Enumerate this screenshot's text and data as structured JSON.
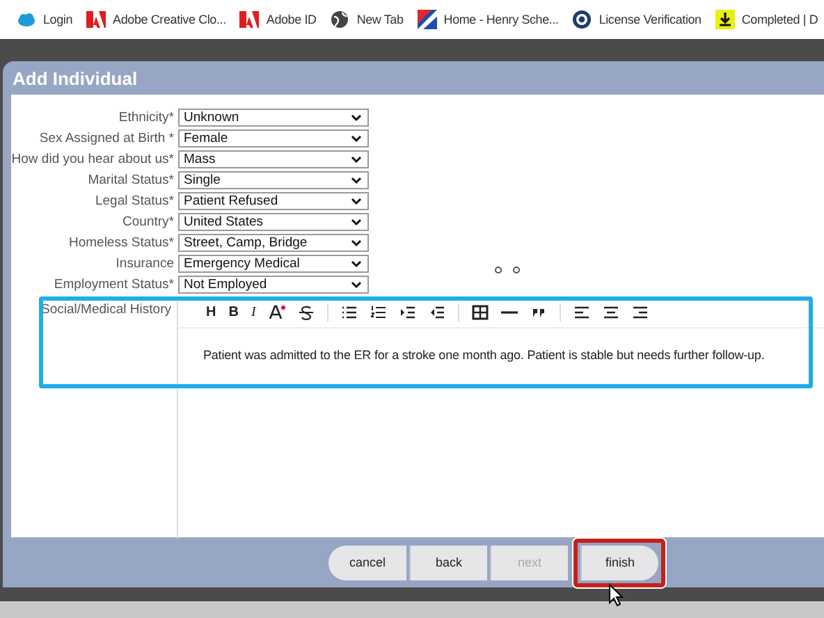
{
  "bookmarks": [
    {
      "label": "Login",
      "kind": "cloud"
    },
    {
      "label": "Adobe Creative Clo...",
      "kind": "adobe"
    },
    {
      "label": "Adobe ID",
      "kind": "adobe"
    },
    {
      "label": "New Tab",
      "kind": "globe"
    },
    {
      "label": "Home - Henry Sche...",
      "kind": "flag"
    },
    {
      "label": "License Verification",
      "kind": "seal"
    },
    {
      "label": "Completed | D",
      "kind": "download"
    }
  ],
  "dialog": {
    "title": "Add Individual",
    "fields": [
      {
        "label": "Ethnicity*",
        "value": "Unknown"
      },
      {
        "label": "Sex Assigned at Birth *",
        "value": "Female"
      },
      {
        "label": "How did you hear about us*",
        "value": "Mass"
      },
      {
        "label": "Marital Status*",
        "value": "Single"
      },
      {
        "label": "Legal Status*",
        "value": "Patient Refused"
      },
      {
        "label": "Country*",
        "value": "United States"
      },
      {
        "label": "Homeless Status*",
        "value": "Street, Camp, Bridge"
      },
      {
        "label": "Insurance",
        "value": "Emergency Medical"
      },
      {
        "label": "Employment Status*",
        "value": "Not Employed"
      }
    ],
    "editor": {
      "label": "Social/Medical History",
      "annotated": true,
      "toolbar": [
        {
          "kind": "glyph",
          "label": "H"
        },
        {
          "kind": "glyph",
          "label": "B"
        },
        {
          "kind": "italic",
          "label": "I"
        },
        {
          "kind": "color"
        },
        {
          "kind": "strike"
        },
        {
          "kind": "separator"
        },
        {
          "kind": "bullets"
        },
        {
          "kind": "numbers"
        },
        {
          "kind": "indent"
        },
        {
          "kind": "outdent"
        },
        {
          "kind": "separator"
        },
        {
          "kind": "table"
        },
        {
          "kind": "rule"
        },
        {
          "kind": "quote"
        },
        {
          "kind": "separator"
        },
        {
          "kind": "align-left"
        },
        {
          "kind": "align-center"
        },
        {
          "kind": "align-right"
        }
      ],
      "text": "Patient was admitted to the ER for a stroke one month ago. Patient is stable but needs further follow-up."
    },
    "buttons": [
      {
        "label": "cancel",
        "disabled": false,
        "annotated": false
      },
      {
        "label": "back",
        "disabled": false,
        "annotated": false
      },
      {
        "label": "next",
        "disabled": true,
        "annotated": false
      },
      {
        "label": "finish",
        "disabled": false,
        "annotated": true
      }
    ]
  }
}
